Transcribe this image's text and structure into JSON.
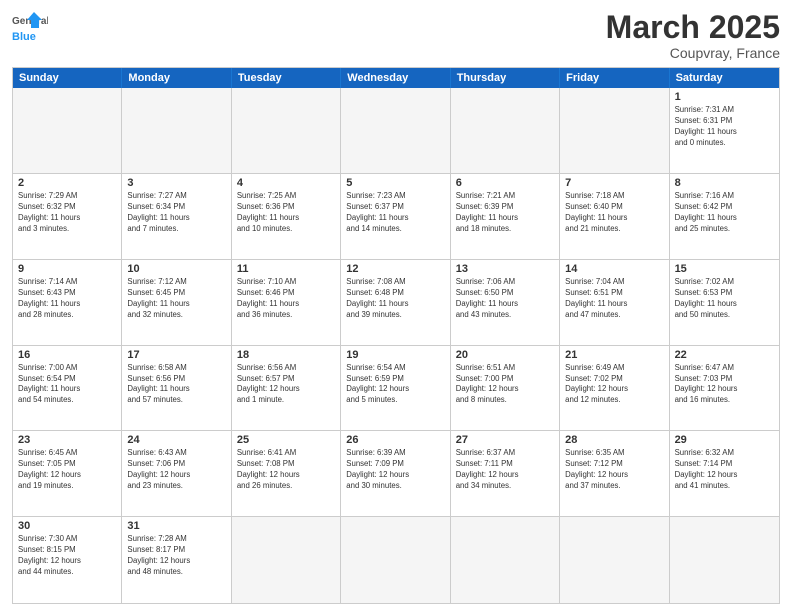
{
  "header": {
    "logo_general": "General",
    "logo_blue": "Blue",
    "title": "March 2025",
    "subtitle": "Coupvray, France"
  },
  "weekdays": [
    "Sunday",
    "Monday",
    "Tuesday",
    "Wednesday",
    "Thursday",
    "Friday",
    "Saturday"
  ],
  "weeks": [
    [
      {
        "day": "",
        "info": ""
      },
      {
        "day": "",
        "info": ""
      },
      {
        "day": "",
        "info": ""
      },
      {
        "day": "",
        "info": ""
      },
      {
        "day": "",
        "info": ""
      },
      {
        "day": "",
        "info": ""
      },
      {
        "day": "1",
        "info": "Sunrise: 7:31 AM\nSunset: 6:31 PM\nDaylight: 11 hours\nand 0 minutes."
      }
    ],
    [
      {
        "day": "2",
        "info": "Sunrise: 7:29 AM\nSunset: 6:32 PM\nDaylight: 11 hours\nand 3 minutes."
      },
      {
        "day": "3",
        "info": "Sunrise: 7:27 AM\nSunset: 6:34 PM\nDaylight: 11 hours\nand 7 minutes."
      },
      {
        "day": "4",
        "info": "Sunrise: 7:25 AM\nSunset: 6:36 PM\nDaylight: 11 hours\nand 10 minutes."
      },
      {
        "day": "5",
        "info": "Sunrise: 7:23 AM\nSunset: 6:37 PM\nDaylight: 11 hours\nand 14 minutes."
      },
      {
        "day": "6",
        "info": "Sunrise: 7:21 AM\nSunset: 6:39 PM\nDaylight: 11 hours\nand 18 minutes."
      },
      {
        "day": "7",
        "info": "Sunrise: 7:18 AM\nSunset: 6:40 PM\nDaylight: 11 hours\nand 21 minutes."
      },
      {
        "day": "8",
        "info": "Sunrise: 7:16 AM\nSunset: 6:42 PM\nDaylight: 11 hours\nand 25 minutes."
      }
    ],
    [
      {
        "day": "9",
        "info": "Sunrise: 7:14 AM\nSunset: 6:43 PM\nDaylight: 11 hours\nand 28 minutes."
      },
      {
        "day": "10",
        "info": "Sunrise: 7:12 AM\nSunset: 6:45 PM\nDaylight: 11 hours\nand 32 minutes."
      },
      {
        "day": "11",
        "info": "Sunrise: 7:10 AM\nSunset: 6:46 PM\nDaylight: 11 hours\nand 36 minutes."
      },
      {
        "day": "12",
        "info": "Sunrise: 7:08 AM\nSunset: 6:48 PM\nDaylight: 11 hours\nand 39 minutes."
      },
      {
        "day": "13",
        "info": "Sunrise: 7:06 AM\nSunset: 6:50 PM\nDaylight: 11 hours\nand 43 minutes."
      },
      {
        "day": "14",
        "info": "Sunrise: 7:04 AM\nSunset: 6:51 PM\nDaylight: 11 hours\nand 47 minutes."
      },
      {
        "day": "15",
        "info": "Sunrise: 7:02 AM\nSunset: 6:53 PM\nDaylight: 11 hours\nand 50 minutes."
      }
    ],
    [
      {
        "day": "16",
        "info": "Sunrise: 7:00 AM\nSunset: 6:54 PM\nDaylight: 11 hours\nand 54 minutes."
      },
      {
        "day": "17",
        "info": "Sunrise: 6:58 AM\nSunset: 6:56 PM\nDaylight: 11 hours\nand 57 minutes."
      },
      {
        "day": "18",
        "info": "Sunrise: 6:56 AM\nSunset: 6:57 PM\nDaylight: 12 hours\nand 1 minute."
      },
      {
        "day": "19",
        "info": "Sunrise: 6:54 AM\nSunset: 6:59 PM\nDaylight: 12 hours\nand 5 minutes."
      },
      {
        "day": "20",
        "info": "Sunrise: 6:51 AM\nSunset: 7:00 PM\nDaylight: 12 hours\nand 8 minutes."
      },
      {
        "day": "21",
        "info": "Sunrise: 6:49 AM\nSunset: 7:02 PM\nDaylight: 12 hours\nand 12 minutes."
      },
      {
        "day": "22",
        "info": "Sunrise: 6:47 AM\nSunset: 7:03 PM\nDaylight: 12 hours\nand 16 minutes."
      }
    ],
    [
      {
        "day": "23",
        "info": "Sunrise: 6:45 AM\nSunset: 7:05 PM\nDaylight: 12 hours\nand 19 minutes."
      },
      {
        "day": "24",
        "info": "Sunrise: 6:43 AM\nSunset: 7:06 PM\nDaylight: 12 hours\nand 23 minutes."
      },
      {
        "day": "25",
        "info": "Sunrise: 6:41 AM\nSunset: 7:08 PM\nDaylight: 12 hours\nand 26 minutes."
      },
      {
        "day": "26",
        "info": "Sunrise: 6:39 AM\nSunset: 7:09 PM\nDaylight: 12 hours\nand 30 minutes."
      },
      {
        "day": "27",
        "info": "Sunrise: 6:37 AM\nSunset: 7:11 PM\nDaylight: 12 hours\nand 34 minutes."
      },
      {
        "day": "28",
        "info": "Sunrise: 6:35 AM\nSunset: 7:12 PM\nDaylight: 12 hours\nand 37 minutes."
      },
      {
        "day": "29",
        "info": "Sunrise: 6:32 AM\nSunset: 7:14 PM\nDaylight: 12 hours\nand 41 minutes."
      }
    ],
    [
      {
        "day": "30",
        "info": "Sunrise: 7:30 AM\nSunset: 8:15 PM\nDaylight: 12 hours\nand 44 minutes."
      },
      {
        "day": "31",
        "info": "Sunrise: 7:28 AM\nSunset: 8:17 PM\nDaylight: 12 hours\nand 48 minutes."
      },
      {
        "day": "",
        "info": ""
      },
      {
        "day": "",
        "info": ""
      },
      {
        "day": "",
        "info": ""
      },
      {
        "day": "",
        "info": ""
      },
      {
        "day": "",
        "info": ""
      }
    ]
  ]
}
